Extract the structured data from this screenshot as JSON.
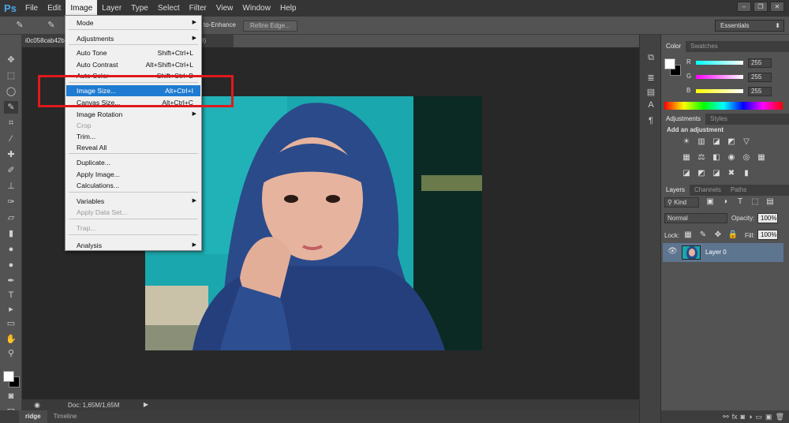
{
  "app": {
    "logo": "Ps"
  },
  "menubar": [
    "File",
    "Edit",
    "Image",
    "Layer",
    "Type",
    "Select",
    "Filter",
    "View",
    "Window",
    "Help"
  ],
  "options_bar": {
    "auto_enhance": "to-Enhance",
    "refine_edge": "Refine Edge..."
  },
  "workspace": {
    "label": "Essentials"
  },
  "document": {
    "tab_label": "i0c058cab42b3",
    "tab_suffix": "8)",
    "doc_status": "Doc: 1,65M/1,65M"
  },
  "bottom_tabs": [
    "ridge",
    "Timeline"
  ],
  "image_menu": {
    "items": [
      {
        "label": "Mode",
        "shortcut": "",
        "submenu": true,
        "disabled": false
      },
      {
        "label": "Adjustments",
        "shortcut": "",
        "submenu": true,
        "disabled": false
      },
      {
        "label": "Auto Tone",
        "shortcut": "Shift+Ctrl+L",
        "submenu": false,
        "disabled": false
      },
      {
        "label": "Auto Contrast",
        "shortcut": "Alt+Shift+Ctrl+L",
        "submenu": false,
        "disabled": false
      },
      {
        "label": "Auto Color",
        "shortcut": "Shift+Ctrl+B",
        "submenu": false,
        "disabled": false
      },
      {
        "label": "Image Size...",
        "shortcut": "Alt+Ctrl+I",
        "submenu": false,
        "disabled": false,
        "highlighted": true
      },
      {
        "label": "Canvas Size...",
        "shortcut": "Alt+Ctrl+C",
        "submenu": false,
        "disabled": false
      },
      {
        "label": "Image Rotation",
        "shortcut": "",
        "submenu": true,
        "disabled": false
      },
      {
        "label": "Crop",
        "shortcut": "",
        "submenu": false,
        "disabled": true
      },
      {
        "label": "Trim...",
        "shortcut": "",
        "submenu": false,
        "disabled": false
      },
      {
        "label": "Reveal All",
        "shortcut": "",
        "submenu": false,
        "disabled": false
      },
      {
        "label": "Duplicate...",
        "shortcut": "",
        "submenu": false,
        "disabled": false
      },
      {
        "label": "Apply Image...",
        "shortcut": "",
        "submenu": false,
        "disabled": false
      },
      {
        "label": "Calculations...",
        "shortcut": "",
        "submenu": false,
        "disabled": false
      },
      {
        "label": "Variables",
        "shortcut": "",
        "submenu": true,
        "disabled": false
      },
      {
        "label": "Apply Data Set...",
        "shortcut": "",
        "submenu": false,
        "disabled": true
      },
      {
        "label": "Trap...",
        "shortcut": "",
        "submenu": false,
        "disabled": true
      },
      {
        "label": "Analysis",
        "shortcut": "",
        "submenu": true,
        "disabled": false
      }
    ]
  },
  "color_panel": {
    "tabs": [
      "Color",
      "Swatches"
    ],
    "channels": [
      {
        "label": "R",
        "value": "255",
        "color": "#ff0000"
      },
      {
        "label": "G",
        "value": "255",
        "color": "#00ff00"
      },
      {
        "label": "B",
        "value": "255",
        "color": "#0000ff"
      }
    ]
  },
  "adjustments_panel": {
    "tabs": [
      "Adjustments",
      "Styles"
    ],
    "heading": "Add an adjustment"
  },
  "layers_panel": {
    "tabs": [
      "Layers",
      "Channels",
      "Paths"
    ],
    "kind_label": "Kind",
    "blend_mode": "Normal",
    "opacity_label": "Opacity:",
    "opacity_value": "100%",
    "lock_label": "Lock:",
    "fill_label": "Fill:",
    "fill_value": "100%",
    "layers": [
      {
        "name": "Layer 0",
        "visible": true
      }
    ]
  },
  "colors": {
    "accent_highlight": "#1f7bd1",
    "annotation_box": "#e0191d",
    "menu_bg": "#f0f0f0"
  }
}
